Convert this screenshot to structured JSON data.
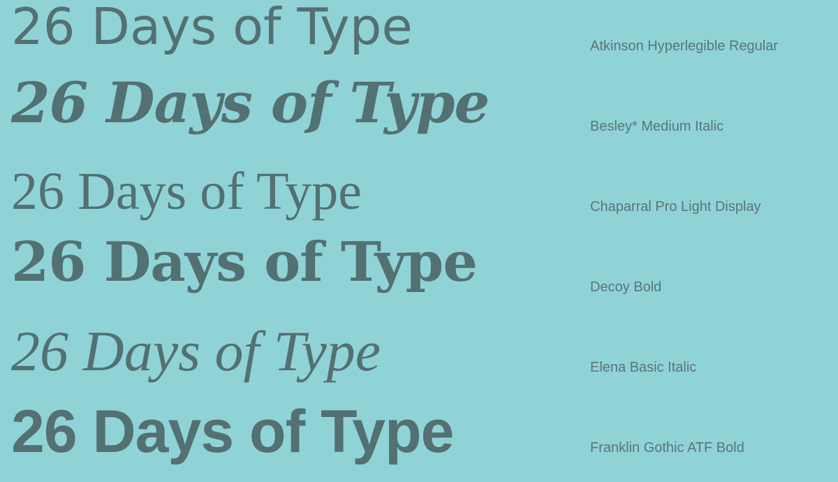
{
  "colors": {
    "background": "#8fd3d7",
    "sample_text": "#537072",
    "label_text": "#5b7476"
  },
  "specimens": [
    {
      "sample": "26 Days of Type",
      "label": "Atkinson Hyperlegible Regular"
    },
    {
      "sample": "26 Days of Type",
      "label": "Besley* Medium Italic"
    },
    {
      "sample": "26 Days of Type",
      "label": "Chaparral Pro Light Display"
    },
    {
      "sample": "26 Days of Type",
      "label": "Decoy Bold"
    },
    {
      "sample": "26 Days of Type",
      "label": "Elena Basic Italic"
    },
    {
      "sample": "26 Days of Type",
      "label": "Franklin Gothic ATF Bold"
    }
  ]
}
